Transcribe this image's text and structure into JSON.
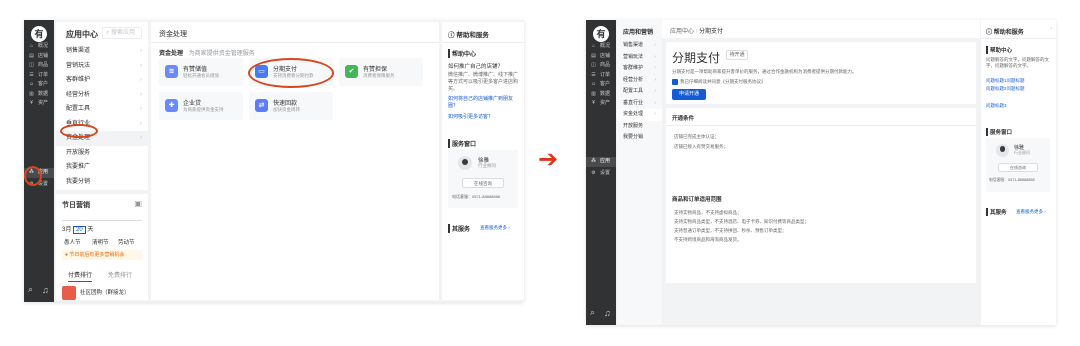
{
  "left": {
    "rail": {
      "logo": "有",
      "items": [
        {
          "icon": "⌂",
          "label": "概况"
        },
        {
          "icon": "▤",
          "label": "店铺"
        },
        {
          "icon": "◫",
          "label": "商品"
        },
        {
          "icon": "☰",
          "label": "订单"
        },
        {
          "icon": "☺",
          "label": "客户"
        },
        {
          "icon": "▥",
          "label": "数据"
        },
        {
          "icon": "¥",
          "label": "资产"
        },
        {
          "icon": "⁂",
          "label": "应用"
        },
        {
          "icon": "⚙",
          "label": "设置"
        }
      ],
      "bottom_icons": [
        "⌕",
        "♫"
      ]
    },
    "sub": {
      "title": "应用中心",
      "search_placeholder": "搜索应用",
      "items": [
        {
          "label": "销售渠道",
          "chev": "›"
        },
        {
          "label": "营销玩法",
          "chev": "›"
        },
        {
          "label": "客群维护",
          "chev": "›"
        },
        {
          "label": "经营分析",
          "chev": "›"
        },
        {
          "label": "配置工具",
          "chev": "›"
        },
        {
          "label": "垂直行业",
          "chev": "›"
        },
        {
          "label": "资金处理",
          "chev": "›"
        },
        {
          "label": "开放服务",
          "chev": ""
        },
        {
          "label": "我要推广",
          "chev": ""
        },
        {
          "label": "我要分销",
          "chev": ""
        }
      ]
    },
    "festival": {
      "title": "节日营销",
      "dates": [
        "3月",
        "20",
        "天"
      ],
      "names": [
        "愚人节",
        "清明节",
        "劳动节"
      ],
      "notice": "节日前后有更多营销机会",
      "tabs": [
        "付费排行",
        "免费排行"
      ],
      "rank_item": "社区团购（群接龙）"
    },
    "main": {
      "title": "资金处理",
      "subtitle": "资金处理",
      "subtitle_desc": "为商家提供资金管理服务",
      "cards": [
        {
          "name": "有赞储值",
          "desc": "轻松开通会员储值",
          "color": "#6a8af7",
          "icon": "≋"
        },
        {
          "name": "分期支付",
          "desc": "支持消费者分期付款",
          "color": "#4a7af0",
          "icon": "▭"
        },
        {
          "name": "有赞担保",
          "desc": "消费者保障服务",
          "color": "#45b658",
          "icon": "✔"
        },
        {
          "name": "企业贷",
          "desc": "为商家提供资金支持",
          "color": "#6a8af7",
          "icon": "✚"
        },
        {
          "name": "快速回款",
          "desc": "加快资金周转",
          "color": "#5f7cf5",
          "icon": "⇄"
        }
      ]
    },
    "help": {
      "title": "帮助和服务",
      "section": "帮助中心",
      "q": "如何推广自己的店铺？",
      "desc": "微信推广、微博推广、线下推广等方式可以吸引更多客户进店购买。",
      "links": [
        "如何将自己的店铺推广到朋友圈？",
        "如何吸引更多访客？"
      ],
      "service": "服务窗口",
      "agent_name": "徐雅",
      "agent_role": "行业顾问",
      "online": "在线咨询",
      "phone": "电话客服：0571-88888888",
      "more_title": "其服务",
      "more_link": "查看服务更多 ›"
    }
  },
  "arrow": "➔",
  "right": {
    "rail": {
      "logo": "有",
      "items": [
        {
          "icon": "⌂",
          "label": "概况"
        },
        {
          "icon": "▤",
          "label": "店铺"
        },
        {
          "icon": "◫",
          "label": "商品"
        },
        {
          "icon": "☰",
          "label": "订单"
        },
        {
          "icon": "☺",
          "label": "客户"
        },
        {
          "icon": "▥",
          "label": "数据"
        },
        {
          "icon": "¥",
          "label": "资产"
        },
        {
          "icon": "⁂",
          "label": "应用"
        },
        {
          "icon": "⚙",
          "label": "设置"
        }
      ],
      "bottom_icons": [
        "⌕",
        "♫"
      ]
    },
    "sub": {
      "title": "应用和营销",
      "items": [
        {
          "label": "销售渠道",
          "chev": "›"
        },
        {
          "label": "营销玩法",
          "chev": "›"
        },
        {
          "label": "客群维护",
          "chev": "›"
        },
        {
          "label": "经营分析",
          "chev": "›"
        },
        {
          "label": "配置工具",
          "chev": "›"
        },
        {
          "label": "垂直行业",
          "chev": "›"
        },
        {
          "label": "资金处理",
          "chev": "›"
        },
        {
          "label": "开放服务",
          "chev": ""
        },
        {
          "label": "我要分销",
          "chev": ""
        }
      ]
    },
    "breadcrumb": [
      "应用中心",
      "分期支付"
    ],
    "detail": {
      "title": "分期支付",
      "badge": "待开通",
      "desc": "分期支付是一项帮助商家提升客单价的服务，通过合作金融机构为消费者提供分期付款能力。",
      "agree": "我已仔细阅读并同意《分期支付服务协议》",
      "button": "申请开通",
      "cond_title": "开通条件",
      "conds": [
        "店铺已完成主体认证；",
        "店铺已接入有赞交易服务；"
      ],
      "scope_title": "商品和订单适用范围",
      "scope": [
        "支持实物商品，不支持虚拟商品；",
        "支持实物商品类型，不支持酒店、电子卡券、知识付费等商品类型；",
        "支持普通订单类型，不支持拼团、秒杀、预售订单类型；",
        "不支持跨境商品和海淘商品发货。"
      ]
    },
    "help": {
      "title": "帮助和服务",
      "section": "帮助中心",
      "desc": "问题解答的文字，问题解答的文字，问题解答的文字。",
      "links": [
        "问题标题1问题标题",
        "问题标题2问题标题",
        "问题标题3"
      ],
      "service": "服务窗口",
      "agent_name": "徐雅",
      "agent_role": "行业顾问",
      "online": "在线咨询",
      "phone": "电话客服：0571-88888888",
      "more_title": "其服务",
      "more_link": "查看服务更多 ›"
    }
  }
}
